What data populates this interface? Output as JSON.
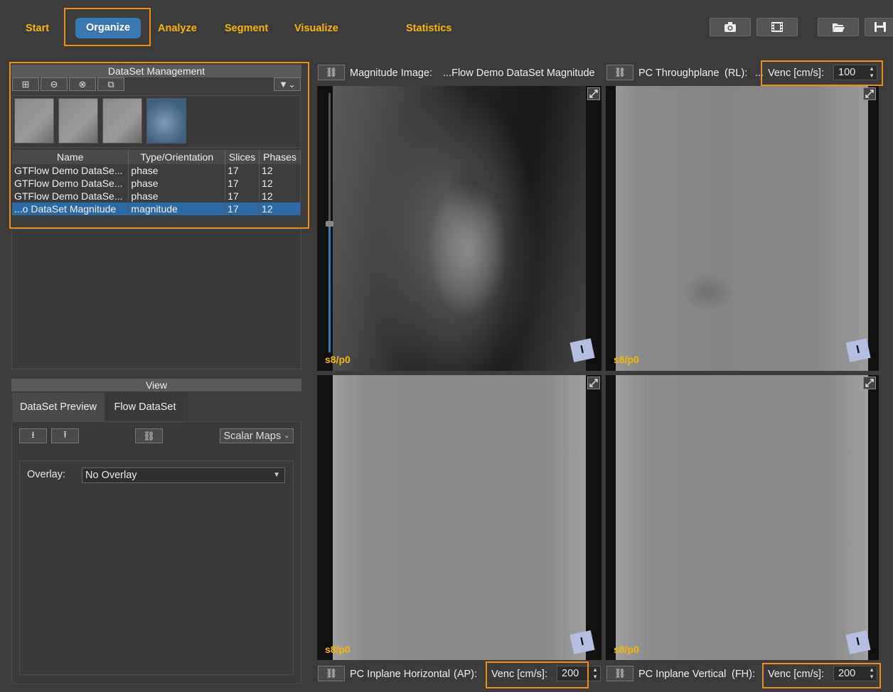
{
  "nav": {
    "items": [
      "Start",
      "Organize",
      "Analyze",
      "Segment",
      "Visualize",
      "Statistics"
    ],
    "active": "Organize"
  },
  "toolbar": {
    "icons": [
      "camera-icon",
      "film-icon",
      "folder-open-icon",
      "save-icon"
    ]
  },
  "dataset_mgmt": {
    "title": "DataSet Management",
    "buttons": [
      "add-icon",
      "remove-icon",
      "close-icon",
      "copy-icon",
      "filter-icon"
    ],
    "columns": [
      "Name",
      "Type/Orientation",
      "Slices",
      "Phases"
    ],
    "rows": [
      {
        "name": "GTFlow Demo DataSe...",
        "type": "phase",
        "slices": "17",
        "phases": "12"
      },
      {
        "name": "GTFlow Demo DataSe...",
        "type": "phase",
        "slices": "17",
        "phases": "12"
      },
      {
        "name": "GTFlow Demo DataSe...",
        "type": "phase",
        "slices": "17",
        "phases": "12"
      },
      {
        "name": "...o DataSet Magnitude",
        "type": "magnitude",
        "slices": "17",
        "phases": "12"
      }
    ]
  },
  "view": {
    "title": "View",
    "tabs": [
      "DataSet Preview",
      "Flow DataSet"
    ],
    "active_tab": "Flow DataSet",
    "scalar_maps": "Scalar Maps",
    "overlay_label": "Overlay:",
    "overlay_value": "No Overlay"
  },
  "viewports": {
    "top_left": {
      "label": "Magnitude Image:",
      "name": "...Flow Demo DataSet Magnitude",
      "slice_phase": "s8/p0"
    },
    "top_right": {
      "label": "PC Throughplane",
      "dir": "(RL):",
      "ellipsis": "...",
      "venc_label": "Venc [cm/s]:",
      "venc": "100",
      "slice_phase": "s8/p0"
    },
    "bottom_left": {
      "label": "PC Inplane Horizontal",
      "dir": "(AP):",
      "venc_label": "Venc [cm/s]:",
      "venc": "200",
      "slice_phase": "s8/p0"
    },
    "bottom_right": {
      "label": "PC Inplane Vertical",
      "dir": "(FH):",
      "venc_label": "Venc [cm/s]:",
      "venc": "200",
      "slice_phase": "s8/p0"
    }
  },
  "colors": {
    "accent": "#f5b800",
    "highlight": "#f08c1a",
    "selection": "#2b6aa5",
    "nav_active": "#3a78b0"
  }
}
